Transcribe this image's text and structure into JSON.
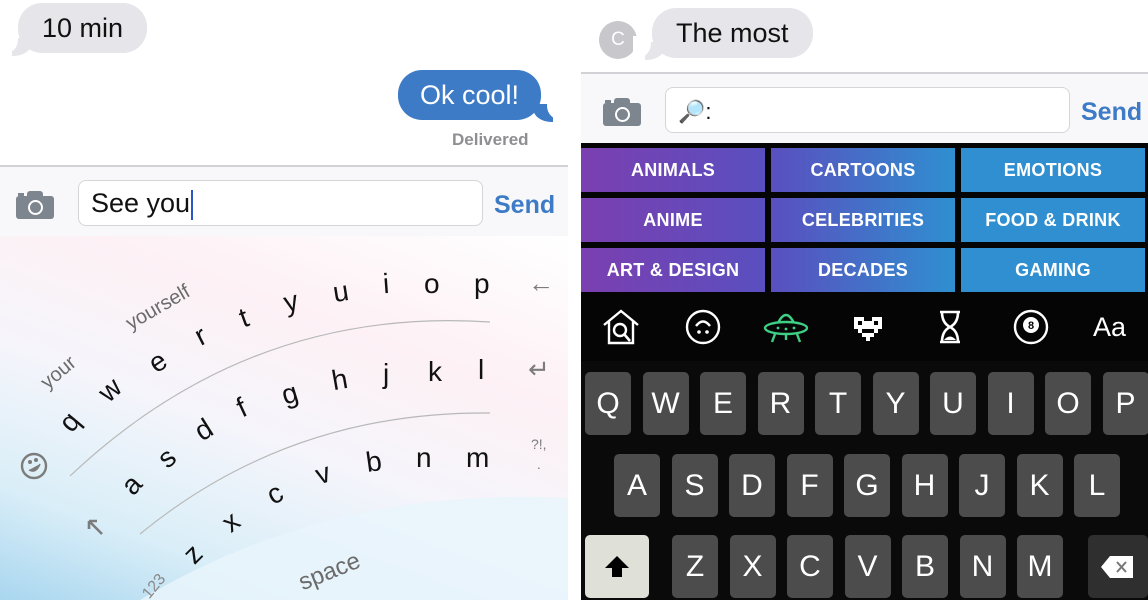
{
  "left": {
    "messages": [
      {
        "direction": "incoming",
        "text": "10 min"
      },
      {
        "direction": "outgoing",
        "text": "Ok cool!"
      }
    ],
    "status": "Delivered",
    "composer": {
      "camera_icon": "camera-icon",
      "input_value": "See you",
      "send_label": "Send"
    },
    "keyboard": {
      "suggestions": [
        "your",
        "yourself"
      ],
      "rows": [
        [
          "q",
          "w",
          "e",
          "r",
          "t",
          "y",
          "u",
          "i",
          "o",
          "p"
        ],
        [
          "a",
          "s",
          "d",
          "f",
          "g",
          "h",
          "j",
          "k",
          "l"
        ],
        [
          "z",
          "x",
          "c",
          "v",
          "b",
          "n",
          "m"
        ]
      ],
      "space_label": "space",
      "numbers_label": "123",
      "punctuation_label": "?!,",
      "punctuation_sub": ".",
      "icons": {
        "backspace": "backspace-arrow-icon",
        "return": "return-icon",
        "emoji": "emoji-icon",
        "shift": "shift-arrow-icon"
      }
    }
  },
  "right": {
    "avatar_initial": "C",
    "messages": [
      {
        "direction": "incoming",
        "text": "The most"
      }
    ],
    "composer": {
      "camera_icon": "camera-icon",
      "input_prefix": "🔎:",
      "input_value": "",
      "send_label": "Send"
    },
    "categories": [
      [
        "ANIMALS",
        "CARTOONS",
        "EMOTIONS"
      ],
      [
        "ANIME",
        "CELEBRITIES",
        "FOOD & DRINK"
      ],
      [
        "ART & DESIGN",
        "DECADES",
        "GAMING"
      ]
    ],
    "category_colors": [
      "#7b3fb0",
      "#5a4fbf",
      "#2f8fd0"
    ],
    "icon_bar": [
      {
        "name": "home-search-icon",
        "active": false
      },
      {
        "name": "upside-down-face-icon",
        "active": false
      },
      {
        "name": "ufo-icon",
        "active": true
      },
      {
        "name": "pixel-heart-icon",
        "active": false
      },
      {
        "name": "hourglass-icon",
        "active": false
      },
      {
        "name": "eight-ball-icon",
        "active": false
      },
      {
        "name": "text-icon",
        "active": false,
        "label": "Aa"
      }
    ],
    "active_icon_color": "#3ecf84",
    "keyboard": {
      "rows": [
        [
          "Q",
          "W",
          "E",
          "R",
          "T",
          "Y",
          "U",
          "I",
          "O",
          "P"
        ],
        [
          "A",
          "S",
          "D",
          "F",
          "G",
          "H",
          "J",
          "K",
          "L"
        ],
        [
          "Z",
          "X",
          "C",
          "V",
          "B",
          "N",
          "M"
        ]
      ],
      "shift_icon": "shift-icon",
      "delete_icon": "delete-icon"
    }
  }
}
